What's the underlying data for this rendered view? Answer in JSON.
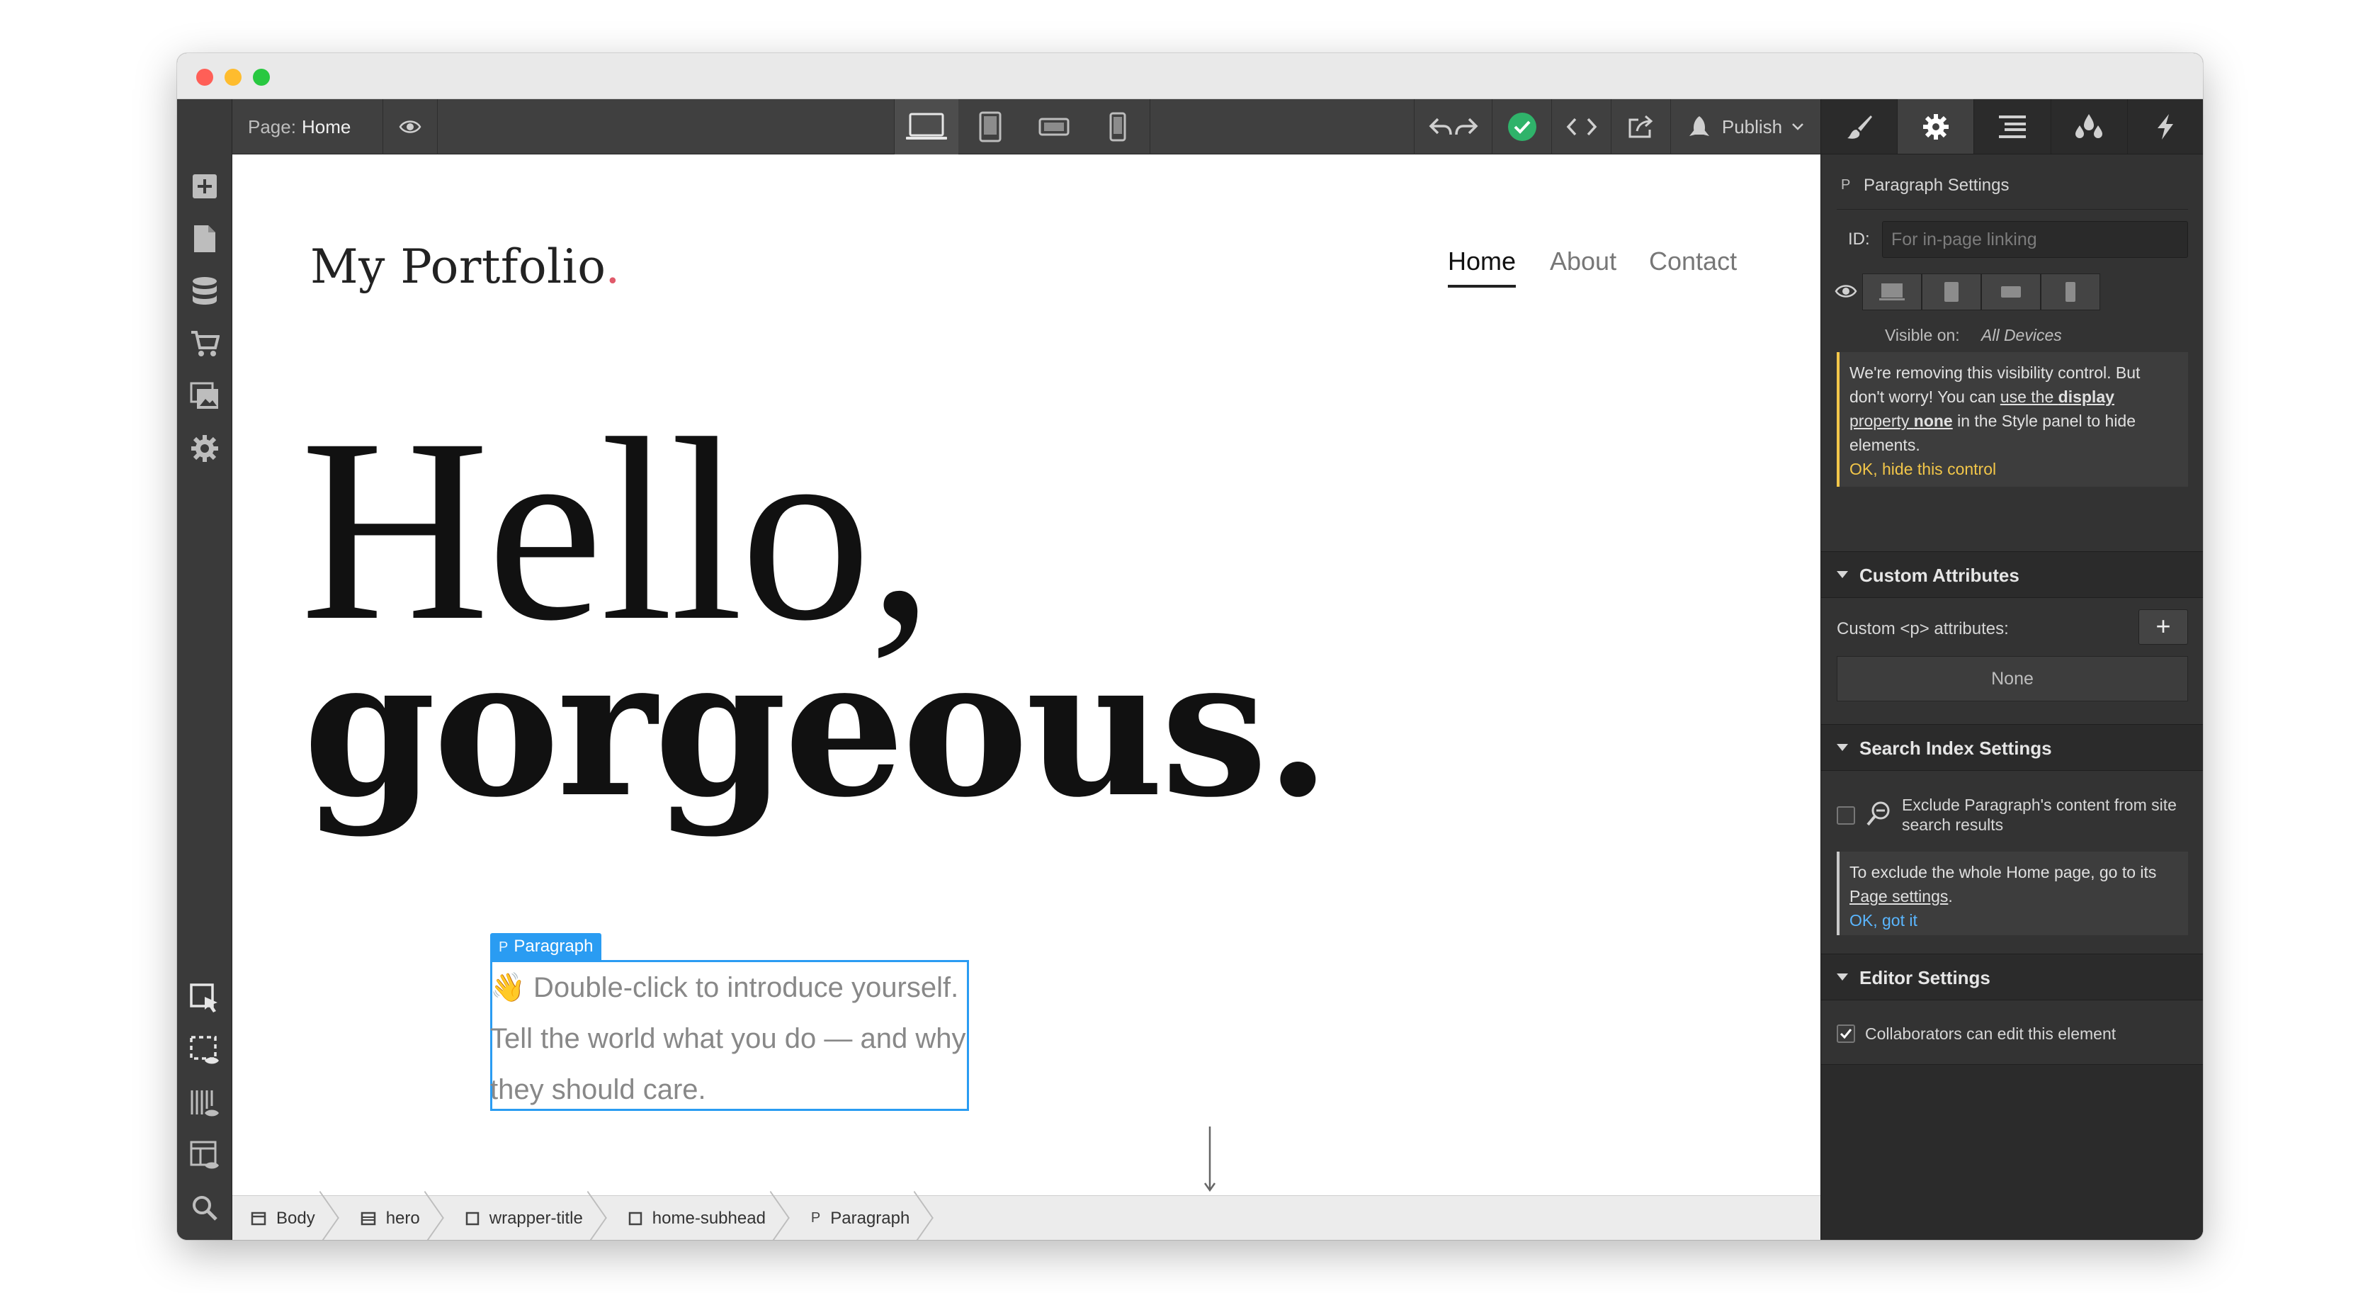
{
  "topbar": {
    "page_label": "Page:",
    "page_name": "Home",
    "publish_label": "Publish"
  },
  "site": {
    "logo_text": "My Portfolio",
    "logo_dot": ".",
    "nav": [
      "Home",
      "About",
      "Contact"
    ],
    "hero_line1": "Hello,",
    "hero_line2": "gorgeous.",
    "selection_tag": "Paragraph",
    "selection_tag_prefix": "P",
    "paragraph_emoji": "👋",
    "paragraph_text": "Double-click to introduce yourself. Tell the world what you do — and why they should care."
  },
  "breadcrumb": [
    {
      "label": "Body",
      "icon": "body-icon"
    },
    {
      "label": "hero",
      "icon": "section-icon"
    },
    {
      "label": "wrapper-title",
      "icon": "div-icon"
    },
    {
      "label": "home-subhead",
      "icon": "div-icon"
    },
    {
      "label": "Paragraph",
      "icon": "paragraph-icon"
    }
  ],
  "panel": {
    "title": "Paragraph Settings",
    "title_prefix": "P",
    "id_label": "ID:",
    "id_placeholder": "For in-page linking",
    "visible_on_label": "Visible on:",
    "visible_on_value": "All Devices",
    "vis_note": {
      "text1": "We're removing this visibility control. But don't worry! You can ",
      "link1": "use the ",
      "link1b": "display",
      "link2": "property ",
      "link2b": "none",
      "text2": " in the Style panel to hide elements.",
      "ok": "OK, hide this control"
    },
    "custom_attrs": {
      "header": "Custom Attributes",
      "label": "Custom <p> attributes:",
      "plus": "+",
      "none": "None"
    },
    "search_index": {
      "header": "Search Index Settings",
      "exclude_text": "Exclude Paragraph's content from site search results",
      "note_text": "To exclude the whole Home page, go to its ",
      "note_link": "Page settings",
      "note_end": ".",
      "ok": "OK, got it"
    },
    "editor_settings": {
      "header": "Editor Settings",
      "collab_text": "Collaborators can edit this element",
      "collab_checked": true
    }
  },
  "colors": {
    "accent_blue": "#2a9cf2",
    "publish_check_green": "#2fb36a",
    "logo_dot_pink": "#e05a6a",
    "warning_yellow": "#f2c649"
  }
}
